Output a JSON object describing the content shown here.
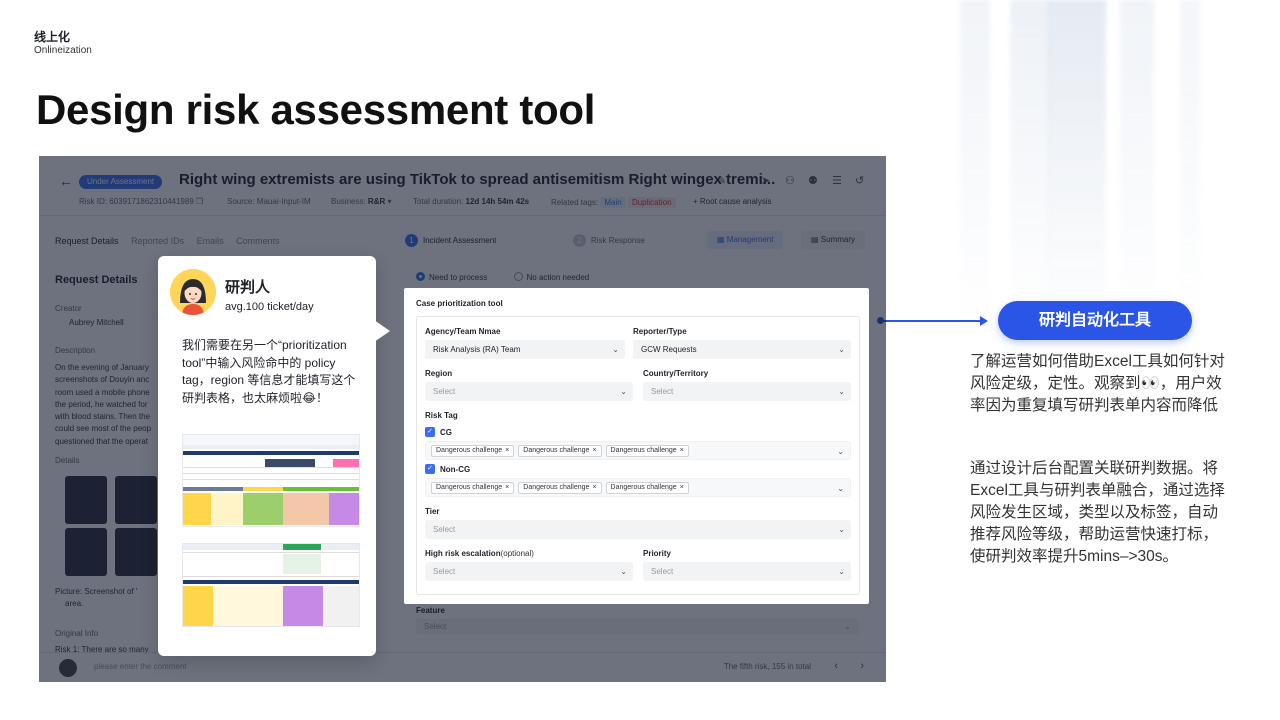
{
  "header": {
    "kicker": "线上化",
    "kicker_sub": "Onlineization",
    "title": "Design risk assessment tool"
  },
  "app": {
    "status_badge": "Under Assessment",
    "case_title": "Right wing extremists are using TikTok to spread antisemitism Right wingex tremi...",
    "meta": {
      "risk_id_label": "Risk ID:",
      "risk_id": "6039171862310441989",
      "source_label": "Source:",
      "source": "Mauai-Input-IM",
      "business_label": "Business:",
      "business": "R&R",
      "duration_label": "Total duration:",
      "duration": "12d 14h 54m 42s",
      "related_label": "Related tags:",
      "tag_main": "Main",
      "tag_dup": "Duplication",
      "root_cause": "+ Root cause analysis"
    },
    "left_tabs": [
      "Request Details",
      "Reported IDs",
      "Emails",
      "Comments"
    ],
    "left_heading": "Request Details",
    "creator_label": "Creator",
    "creator_name": "Aubrey Mitchell",
    "description_label": "Description",
    "description_lines": [
      "On the evening of January",
      "screenshots of Douyin anc",
      "room used a mobile phone",
      "the period, he watched for",
      "with blood stains. Then the",
      "could see most of the peop",
      "questioned that the operat"
    ],
    "details_label": "Details",
    "picture_caption_1": "Picture: Screenshot of '",
    "picture_caption_2": "area.",
    "original_info_label": "Original Info",
    "original_info_text": "Risk 1: There are so many",
    "comment_placeholder": "please enter the comment",
    "pager_text": "The fifth risk, 155 in total",
    "steps": [
      {
        "num": "1",
        "label": "Incident Assessment"
      },
      {
        "num": "2",
        "label": "Risk Response"
      }
    ],
    "management_label": "Management",
    "summary_label": "Summary",
    "radio_need": "Need to process",
    "radio_no": "No action needed",
    "feature_label": "Feature",
    "feature_placeholder": "Select"
  },
  "form": {
    "heading": "Case prioritization tool",
    "agency_label": "Agency/Team Nmae",
    "agency_value": "Risk Analysis (RA) Team",
    "reporter_label": "Reporter/Type",
    "reporter_value": "GCW Requests",
    "region_label": "Region",
    "region_placeholder": "Select",
    "country_label": "Country/Territory",
    "country_placeholder": "Select",
    "risk_tag_label": "Risk Tag",
    "cg_label": "CG",
    "cg_chips": [
      "Dangerous challenge",
      "Dangerous challenge",
      "Dangerous challenge"
    ],
    "noncg_label": "Non-CG",
    "noncg_chips": [
      "Dangerous challenge",
      "Dangerous challenge",
      "Dangerous challenge"
    ],
    "tier_label": "Tier",
    "tier_placeholder": "Select",
    "escalation_label": "High risk escalation",
    "escalation_optional": "(optional)",
    "escalation_placeholder": "Select",
    "priority_label": "Priority",
    "priority_placeholder": "Select"
  },
  "bubble": {
    "name": "研判人",
    "sub": "avg.100 ticket/day",
    "text": "我们需要在另一个“prioritization tool”中输入风险命中的 policy tag，region 等信息才能填写这个研判表格，也太麻烦啦😂！"
  },
  "right": {
    "pill": "研判自动化工具",
    "para1": "了解运营如何借助Excel工具如何针对风险定级，定性。观察到👀，用户效率因为重复填写研判表单内容而降低",
    "para2": "通过设计后台配置关联研判数据。将Excel工具与研判表单融合，通过选择风险发生区域，类型以及标签，自动推荐风险等级，帮助运营快速打标，使研判效率提升5mins–>30s。"
  },
  "colors": {
    "accent": "#2b55e6",
    "app_primary": "#3a6df0"
  },
  "icons": [
    "back-arrow-icon",
    "edit-icon",
    "send-icon",
    "user-icon",
    "users-icon",
    "list-icon",
    "history-icon",
    "copy-icon",
    "chevron-down-icon",
    "close-icon",
    "check-icon",
    "arrow-right-icon"
  ]
}
